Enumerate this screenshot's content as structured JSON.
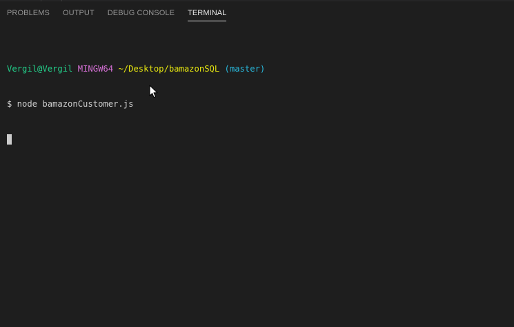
{
  "panel_tabs": [
    {
      "label": "PROBLEMS",
      "active": false
    },
    {
      "label": "OUTPUT",
      "active": false
    },
    {
      "label": "DEBUG CONSOLE",
      "active": false
    },
    {
      "label": "TERMINAL",
      "active": true
    }
  ],
  "terminal": {
    "prompt": {
      "user_host": "Vergil@Vergil",
      "system": "MINGW64",
      "cwd": "~/Desktop/bamazonSQL",
      "branch": "(master)"
    },
    "command_line": "$ node bamazonCustomer.js"
  },
  "colors": {
    "background": "#1e1e1e",
    "user_host": "#23d18b",
    "system": "#d670d6",
    "cwd": "#e5e510",
    "branch": "#29b8db",
    "text": "#cccccc"
  },
  "icons": {
    "mouse": "mouse-pointer-icon"
  }
}
